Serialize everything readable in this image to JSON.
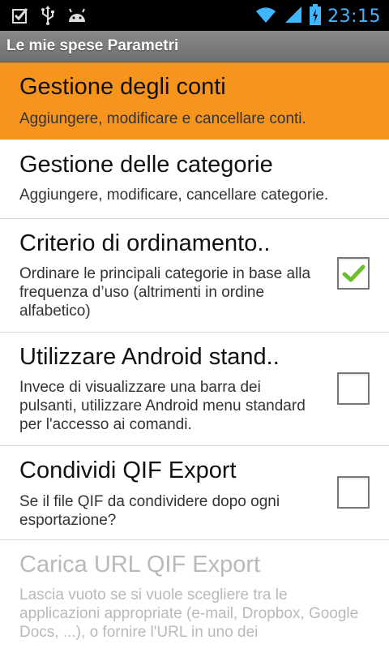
{
  "status_bar": {
    "time": "23:15",
    "icons": [
      "checkbox-notification-icon",
      "usb-icon",
      "android-debug-icon",
      "wifi-icon",
      "signal-icon",
      "battery-charging-icon"
    ]
  },
  "title_bar": {
    "title": "Le mie spese Parametri"
  },
  "preferences": [
    {
      "title": "Gestione degli conti",
      "summary": "Aggiungere, modificare e cancellare conti.",
      "selected": true
    },
    {
      "title": "Gestione delle categorie",
      "summary": "Aggiungere, modificare, cancellare categorie."
    },
    {
      "title": "Criterio di ordinamento..",
      "summary": "Ordinare le principali categorie in base alla frequenza d’uso (altrimenti in ordine alfabetico)",
      "checked": true
    },
    {
      "title": "Utilizzare Android stand..",
      "summary": "Invece di visualizzare una barra dei pulsanti, utilizzare Android menu standard per l'accesso ai comandi.",
      "checked": false
    },
    {
      "title": "Condividi QIF Export",
      "summary": "Se il file QIF da condividere dopo ogni esportazione?",
      "checked": false
    },
    {
      "title": "Carica URL QIF Export",
      "summary": "Lascia vuoto se si vuole scegliere tra le applicazioni appropriate (e-mail, Dropbox, Google Docs, ...), o fornire l'URL in uno dei",
      "enabled": false
    }
  ],
  "colors": {
    "selected_bg": "#f7941d",
    "clock": "#3fb6ff",
    "check": "#6dbe2d"
  }
}
